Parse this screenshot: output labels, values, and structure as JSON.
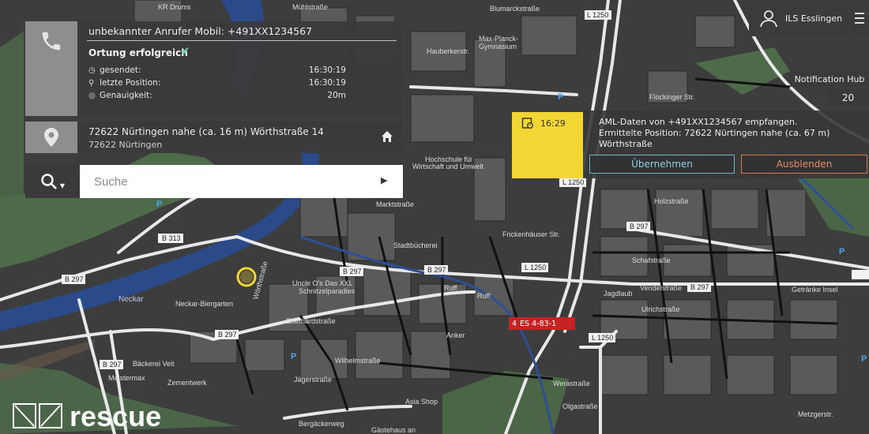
{
  "caller": {
    "title": "unbekannter Anrufer Mobil: +491XX1234567",
    "status": "Ortung erfolgreich",
    "rows": [
      {
        "icon": "clock-icon",
        "label": "gesendet:",
        "value": "16:30:19"
      },
      {
        "icon": "location-pin-icon",
        "label": "letzte Position:",
        "value": "16:30:19"
      },
      {
        "icon": "accuracy-icon",
        "label": "Genauigkeit:",
        "value": "20m"
      }
    ]
  },
  "address": {
    "line1": "72622 Nürtingen nahe (ca. 16 m) Wörthstraße 14",
    "line2": "72622 Nürtingen"
  },
  "search": {
    "placeholder": "Suche"
  },
  "user": {
    "name": "ILS Esslingen"
  },
  "notification_hub": {
    "label": "Notification Hub",
    "count": "20"
  },
  "notification": {
    "time": "16:29",
    "line1": "AML-Daten von +491XX1234567 empfangen.",
    "line2": "Ermittelte Position: 72622 Nürtingen nahe (ca. 67 m)",
    "line3": "Wörthstraße",
    "accept_label": "Übernehmen",
    "dismiss_label": "Ausblenden"
  },
  "unit_badge": {
    "number": "4",
    "label": "ES 4-83-1"
  },
  "logo": {
    "text": "rescue"
  },
  "colors": {
    "accent_teal": "#6fb4c6",
    "accent_orange": "#d87552",
    "sticky_yellow": "#f3d634",
    "success_green": "#6fd3b0",
    "badge_red": "#c62323",
    "river_blue": "#2b4a8a"
  },
  "map_labels": {
    "kr_drums": "KR Drums",
    "muehlstrasse": "Mühlstraße",
    "blumarckstrasse": "Blumarckstraße",
    "l1250": "L 1250",
    "hauberkerstr": "Hauberkerstr.",
    "max_planck": "Max-Planck-",
    "gymnasium": "Gymnasium",
    "flockinger": "Flockinger Str.",
    "hochschule": "Hochschule für",
    "wirtschaft": "Wirtschaft und Umwelt",
    "b313": "B 313",
    "b297": "B 297",
    "neckar": "Neckar",
    "neckar_biergarten": "Neckar-Biergarten",
    "stadtbuecherei": "Stadtbücherei",
    "uncle_os": "Uncle O's Das XXL",
    "schnitzelparadies": "Schnitzelparadies",
    "woerthstrasse": "Wörthstraße",
    "eberhardstrasse": "Eberhardstraße",
    "ruff": "Ruff",
    "anker": "Anker",
    "ruff_hum": "Ruff",
    "schafstrasse": "Schafstraße",
    "vendelstrasse": "Vendelstraße",
    "ulrichstrasse": "Ulrichstraße",
    "getraenke_insel": "Getränke Insel",
    "baeckerei_veit": "Bäckerei Veit",
    "meistermax": "Meistermax",
    "zementwerk": "Zementwerk",
    "asia_shop": "Asia Shop",
    "werastrasse": "Werastraße",
    "olgastrasse": "Olgastraße",
    "jaegerstrasse": "Jägerstraße",
    "wilhelmstrasse": "Wilhelmstraße",
    "frickenhaeuser": "Frickenhäuser Str.",
    "holzstrasse": "Holzstraße",
    "marktstrasse": "Marktstraße",
    "bergaeckerweg": "Bergäckerweg",
    "gaestehaus": "Gästehaus an",
    "jagdlaub": "Jagdlaub",
    "metzgerstrasse": "Metzgerstr."
  }
}
